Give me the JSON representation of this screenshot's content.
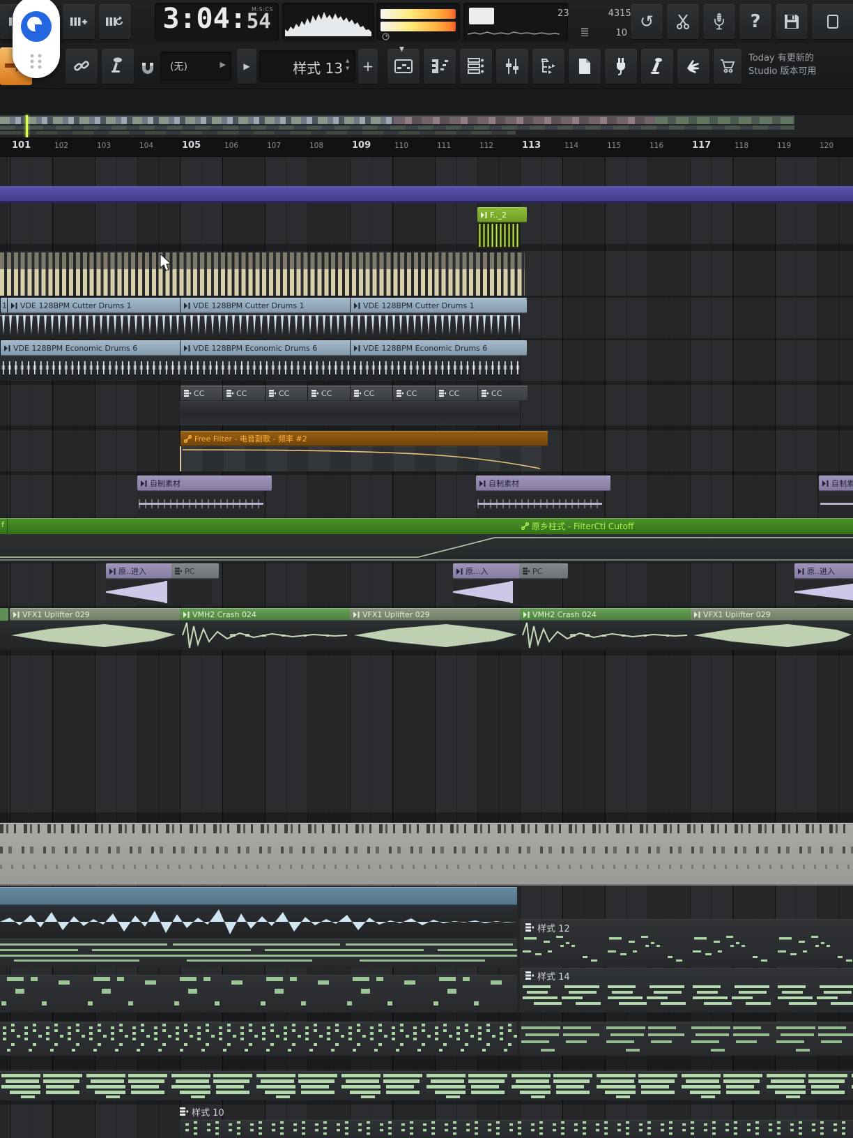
{
  "toolbar": {
    "time": {
      "main": "3:04:",
      "centiseconds": "54",
      "format_label": "M:S:CS"
    },
    "cpu_percent": "23",
    "memory": "4315 MB",
    "disk_value": "10",
    "snap_value": "(无)",
    "pattern_selector": {
      "name": "样式 13",
      "add_label": "+"
    },
    "update_notice": {
      "line1": "Today 有更新的",
      "line2": "Studio 版本可用"
    },
    "help_label": "?"
  },
  "timeline": {
    "bars": [
      "101",
      "102",
      "103",
      "104",
      "105",
      "106",
      "107",
      "108",
      "109",
      "110",
      "111",
      "112",
      "113",
      "114",
      "115",
      "116",
      "117",
      "118",
      "119",
      "120"
    ]
  },
  "playlist": {
    "clips": {
      "f2": "F.._2",
      "cutter": "VDE 128BPM Cutter Drums 1",
      "cutter_fragment": "1",
      "economic": "VDE 128BPM Economic Drums 6",
      "cc": "CC",
      "free_filter": "Free Filter - 电音副歌 - 频率 #2",
      "homemade": "自制素材",
      "filterctl": "原乡柱式 - FilterCtl Cutoff",
      "filterctl_fragment": "f",
      "intro": "原..进入",
      "intro_mid": "原...入",
      "pc": "PC",
      "uplifter": "VFX1 Uplifter 029",
      "crash": "VMH2 Crash 024",
      "pattern12": "样式 12",
      "pattern14": "样式 14",
      "pattern10": "样式 10"
    }
  },
  "palette": {
    "accent_orange": "#e8872a",
    "marker_purple": "#4f46a2",
    "clip_steel": "#92aabf",
    "clip_lime": "#84b22c",
    "clip_automation_orange": "#8a5410",
    "clip_automation_green": "#3e8420",
    "clip_purple": "#9489ae",
    "clip_olive": "#7d8a74",
    "clip_crash_green": "#5f8f55",
    "clip_slate": "#5e7f95",
    "note_green": "#a9d6a2",
    "tan_bars": "#d9d0ab",
    "playhead_green": "#d9ff4d"
  }
}
